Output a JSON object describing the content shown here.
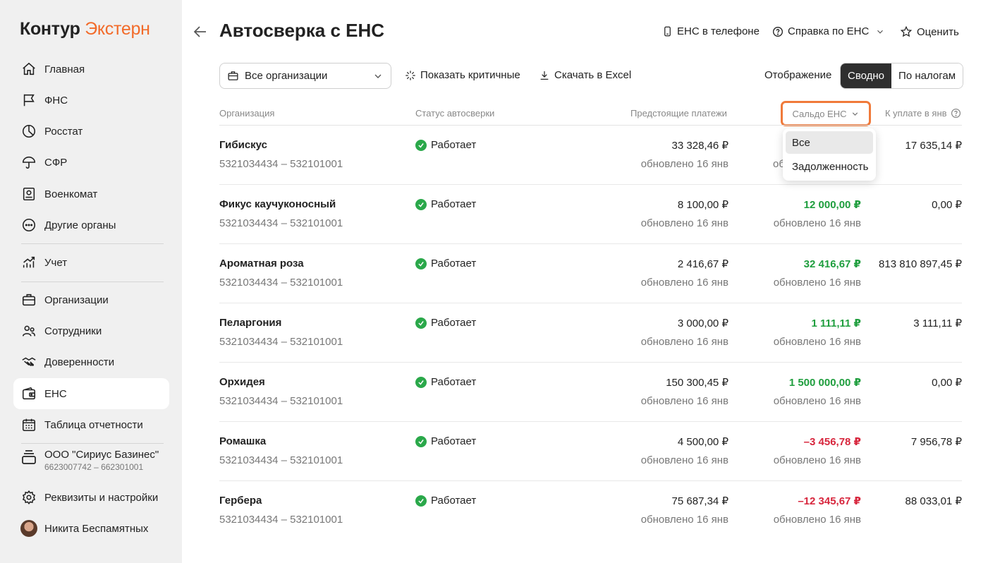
{
  "brand": {
    "part1": "Контур",
    "part2": "Экстерн",
    "accent_color": "#f26b2a"
  },
  "sidebar": {
    "items": [
      {
        "label": "Главная",
        "icon": "home-icon"
      },
      {
        "label": "ФНС",
        "icon": "flag-icon"
      },
      {
        "label": "Росстат",
        "icon": "pie-chart-icon"
      },
      {
        "label": "СФР",
        "icon": "umbrella-icon"
      },
      {
        "label": "Военкомат",
        "icon": "portrait-icon"
      },
      {
        "label": "Другие органы",
        "icon": "more-circle-icon"
      },
      {
        "label": "Учет",
        "icon": "growth-chart-icon"
      },
      {
        "label": "Организации",
        "icon": "briefcase-icon"
      },
      {
        "label": "Сотрудники",
        "icon": "people-icon"
      },
      {
        "label": "Доверенности",
        "icon": "handshake-icon"
      },
      {
        "label": "ЕНС",
        "icon": "wallet-icon",
        "active": true
      },
      {
        "label": "Таблица отчетности",
        "icon": "calendar-icon"
      }
    ],
    "org": {
      "name": "ООО \"Сириус Базинес\"",
      "inn": "6623007742 – 662301001"
    },
    "settings_label": "Реквизиты и настройки",
    "user_name": "Никита Беспамятных"
  },
  "header": {
    "title": "Автосверка с ЕНС",
    "phone_link": "ЕНС в телефоне",
    "help_link": "Справка по ЕНС",
    "rate_link": "Оценить"
  },
  "toolbar": {
    "org_select_value": "Все организации",
    "critical_label": "Показать критичные",
    "excel_label": "Скачать в Excel",
    "view_label": "Отображение",
    "view_summary": "Сводно",
    "view_by_tax": "По налогам"
  },
  "table": {
    "headers": {
      "org": "Организация",
      "status": "Статус автосверки",
      "payments": "Предстоящие платежи",
      "saldo": "Сальдо ЕНС",
      "due": "К уплате в янв"
    },
    "rows": [
      {
        "name": "Гибискус",
        "inn": "5321034434 – 532101001",
        "status": "Работает",
        "payments": "33 328,46 ₽",
        "payments_updated": "обновлено 16 янв",
        "saldo": "",
        "saldo_updated": "об",
        "saldo_sign": "pos",
        "due": "17 635,14 ₽"
      },
      {
        "name": "Фикус каучуконосный",
        "inn": "5321034434 – 532101001",
        "status": "Работает",
        "payments": "8 100,00 ₽",
        "payments_updated": "обновлено 16 янв",
        "saldo": "12 000,00 ₽",
        "saldo_updated": "обновлено 16 янв",
        "saldo_sign": "pos",
        "due": "0,00 ₽"
      },
      {
        "name": "Ароматная роза",
        "inn": "5321034434 – 532101001",
        "status": "Работает",
        "payments": "2 416,67 ₽",
        "payments_updated": "обновлено 16 янв",
        "saldo": "32 416,67 ₽",
        "saldo_updated": "обновлено 16 янв",
        "saldo_sign": "pos",
        "due": "813 810 897,45 ₽"
      },
      {
        "name": "Пеларгония",
        "inn": "5321034434 – 532101001",
        "status": "Работает",
        "payments": "3 000,00 ₽",
        "payments_updated": "обновлено 16 янв",
        "saldo": "1 111,11 ₽",
        "saldo_updated": "обновлено 16 янв",
        "saldo_sign": "pos",
        "due": "3 111,11 ₽"
      },
      {
        "name": "Орхидея",
        "inn": "5321034434 – 532101001",
        "status": "Работает",
        "payments": "150 300,45 ₽",
        "payments_updated": "обновлено 16 янв",
        "saldo": "1 500 000,00 ₽",
        "saldo_updated": "обновлено 16 янв",
        "saldo_sign": "pos",
        "due": "0,00 ₽"
      },
      {
        "name": "Ромашка",
        "inn": "5321034434 – 532101001",
        "status": "Работает",
        "payments": "4 500,00 ₽",
        "payments_updated": "обновлено 16 янв",
        "saldo": "–3 456,78 ₽",
        "saldo_updated": "обновлено 16 янв",
        "saldo_sign": "neg",
        "due": "7 956,78 ₽"
      },
      {
        "name": "Гербера",
        "inn": "5321034434 – 532101001",
        "status": "Работает",
        "payments": "75 687,34 ₽",
        "payments_updated": "обновлено 16 янв",
        "saldo": "–12 345,67 ₽",
        "saldo_updated": "обновлено 16 янв",
        "saldo_sign": "neg",
        "due": "88 033,01 ₽"
      }
    ]
  },
  "saldo_dropdown": {
    "options": [
      "Все",
      "Задолженность"
    ],
    "selected": "Все"
  },
  "colors": {
    "positive": "#1f9e3e",
    "negative": "#d7263d",
    "status_ok": "#2aa84a",
    "highlight_border": "#f07a3a"
  }
}
